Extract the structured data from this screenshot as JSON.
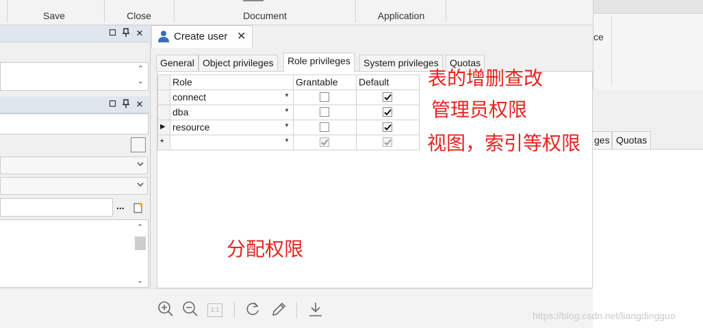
{
  "ribbon": {
    "groups": [
      "Save",
      "Close",
      "Document",
      "Application"
    ],
    "right_fragment": "ce"
  },
  "document_tab": {
    "title": "Create user",
    "close_glyph": "✕"
  },
  "left_panel": {
    "controls": {
      "pin": "📌",
      "close": "✕"
    },
    "ellipsis": "..."
  },
  "inner_tabs": [
    {
      "label": "General"
    },
    {
      "label": "Object privileges"
    },
    {
      "label": "Role privileges",
      "active": true
    },
    {
      "label": "System privileges"
    },
    {
      "label": "Quotas"
    }
  ],
  "right_tabs": {
    "partial": "ges",
    "quotas": "Quotas"
  },
  "grid": {
    "columns": [
      "Role",
      "Grantable",
      "Default"
    ],
    "rows": [
      {
        "indicator": "",
        "role": "connect",
        "grantable": false,
        "default": true
      },
      {
        "indicator": "",
        "role": "dba",
        "grantable": false,
        "default": true
      },
      {
        "indicator": "▶",
        "role": "resource",
        "grantable": false,
        "default": true
      },
      {
        "indicator": "*",
        "role": "",
        "grantable": true,
        "default": true,
        "new_row": true
      }
    ]
  },
  "annotations": {
    "line1": "表的增删查改",
    "line2": "管理员权限",
    "line3": "视图，索引等权限",
    "center": "分配权限"
  },
  "bottom_toolbar": {
    "icons": [
      "zoom-in-icon",
      "zoom-out-icon",
      "actual-size-icon",
      "rotate-icon",
      "edit-pen-icon",
      "download-icon"
    ],
    "actual_size_label": "1:1"
  },
  "watermark": "https://blog.csdn.net/liangdingguo",
  "colors": {
    "annotation": "#e8231e",
    "panel_header": "#e0e6ee"
  }
}
